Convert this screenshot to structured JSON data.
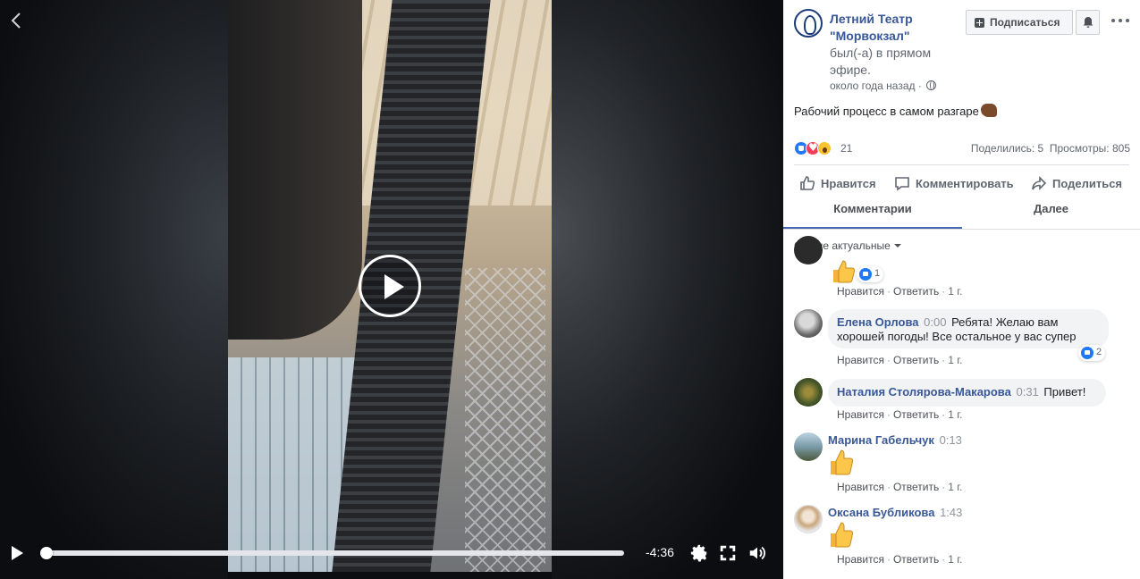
{
  "video": {
    "time_remaining": "-4:36",
    "progress_fraction": 0.0
  },
  "post": {
    "page_name": "Летний Театр \"Морвокзал\"",
    "live_status": "был(-а) в прямом эфире.",
    "time_ago": "около года назад ·",
    "subscribe_label": "Подписаться",
    "text": "Рабочий процесс в самом разгаре",
    "reaction_count": "21",
    "stats": "Поделились: 5  Просмотры: 805",
    "actions": {
      "like": "Нравится",
      "comment": "Комментировать",
      "share": "Поделиться"
    },
    "tabs": {
      "comments": "Комментарии",
      "more": "Далее"
    },
    "sort_label": "Самые актуальные"
  },
  "comment_actions": {
    "like": "Нравится",
    "reply": "Ответить",
    "age": "1 г."
  },
  "comments": [
    {
      "reaction_count": "1"
    },
    {
      "name": "Елена Орлова",
      "timestamp": "0:00",
      "text_line1": "Ребята! Желаю вам",
      "text_line2": "хорошей погоды! Все остальное у вас супер",
      "reaction_count": "2"
    },
    {
      "name": "Наталия Столярова-Макарова",
      "timestamp": "0:31",
      "text": "Привет!"
    },
    {
      "name": "Марина Габельчук",
      "timestamp": "0:13"
    },
    {
      "name": "Оксана Бубликова",
      "timestamp": "1:43"
    }
  ],
  "colors": {
    "link_blue": "#385898",
    "accent": "#4267b2",
    "like_blue": "#2078f4"
  }
}
